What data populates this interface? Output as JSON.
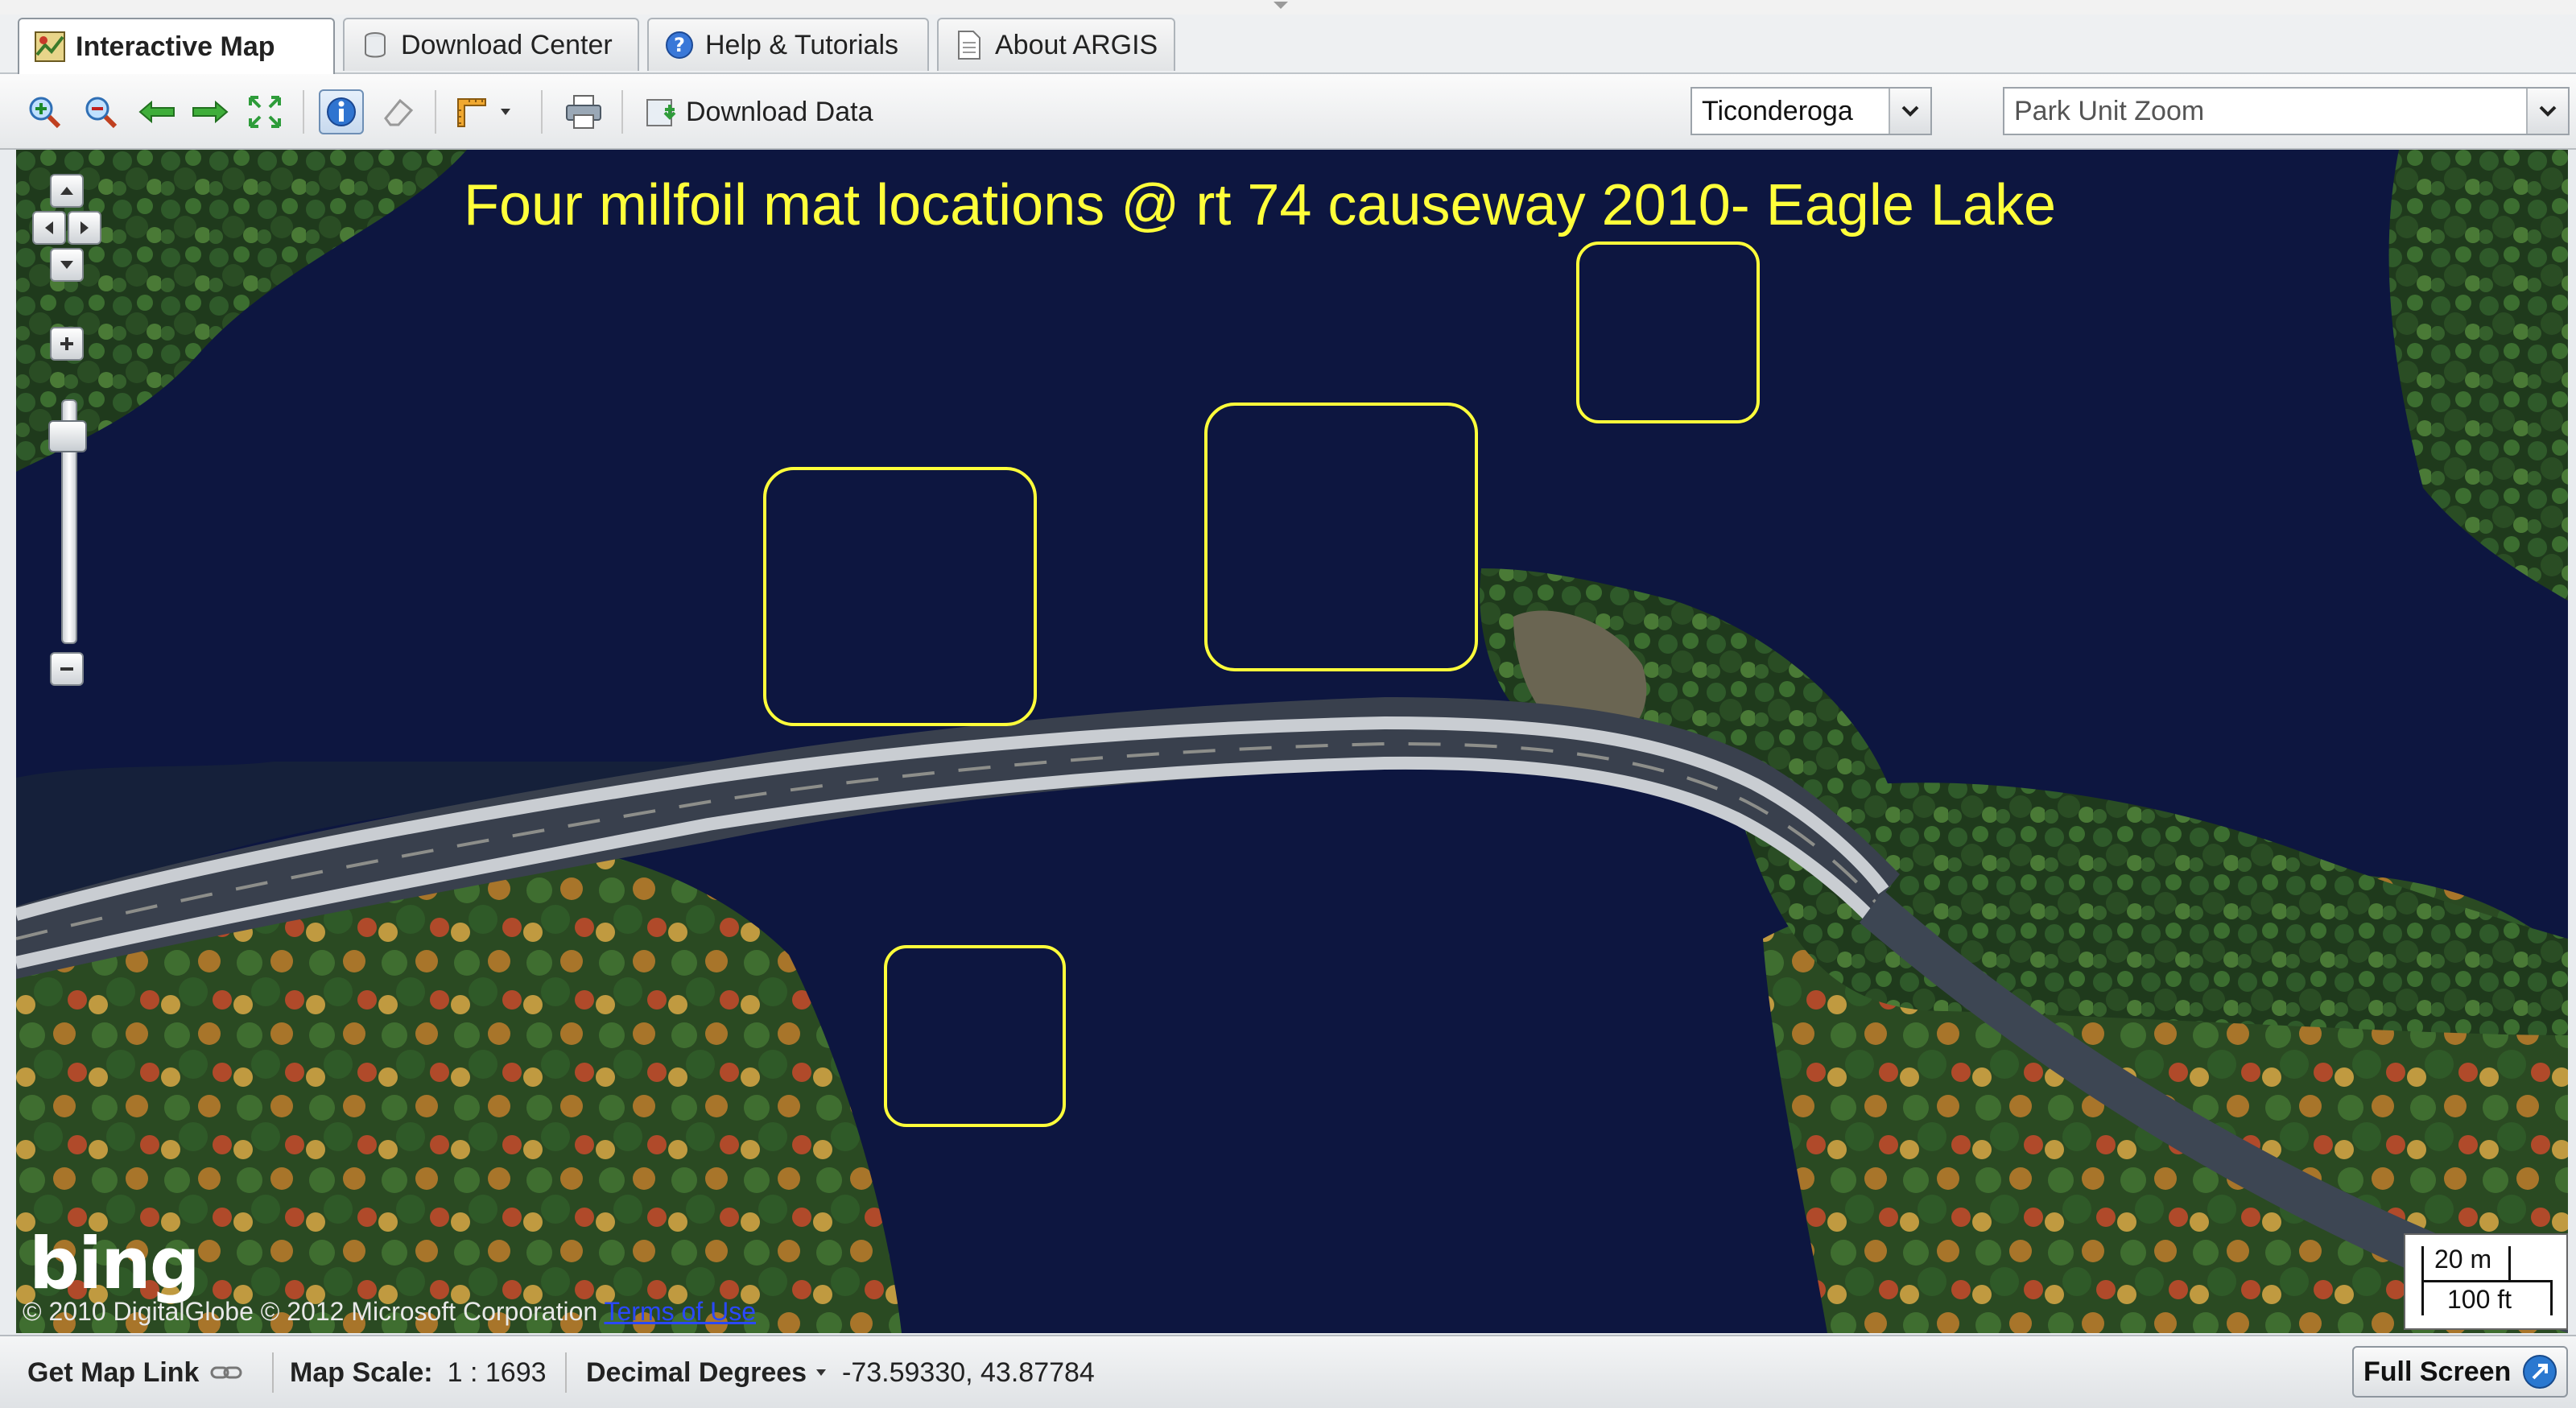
{
  "tabs": [
    {
      "label": "Interactive Map",
      "active": true,
      "icon": "map-icon"
    },
    {
      "label": "Download Center",
      "active": false,
      "icon": "database-icon"
    },
    {
      "label": "Help & Tutorials",
      "active": false,
      "icon": "help-icon"
    },
    {
      "label": "About ARGIS",
      "active": false,
      "icon": "document-icon"
    }
  ],
  "toolbar": {
    "download_label": "Download Data",
    "town_select": {
      "value": "Ticonderoga"
    },
    "park_select": {
      "placeholder": "Park Unit Zoom"
    }
  },
  "map": {
    "title": "Four milfoil mat locations @ rt 74 causeway 2010- Eagle Lake",
    "logo": "bing",
    "copyright": "© 2010 DigitalGlobe © 2012 Microsoft Corporation",
    "terms_link": "Terms of Use",
    "scale_metric": "20 m",
    "scale_imperial": "100 ft",
    "highlight_color": "#ffff3a",
    "water_color": "#0d1640"
  },
  "status": {
    "map_link": "Get Map Link",
    "scale_label": "Map Scale:",
    "scale_value": "1 : 1693",
    "coord_format": "Decimal Degrees",
    "coords": "-73.59330, 43.87784",
    "full_screen": "Full Screen"
  }
}
